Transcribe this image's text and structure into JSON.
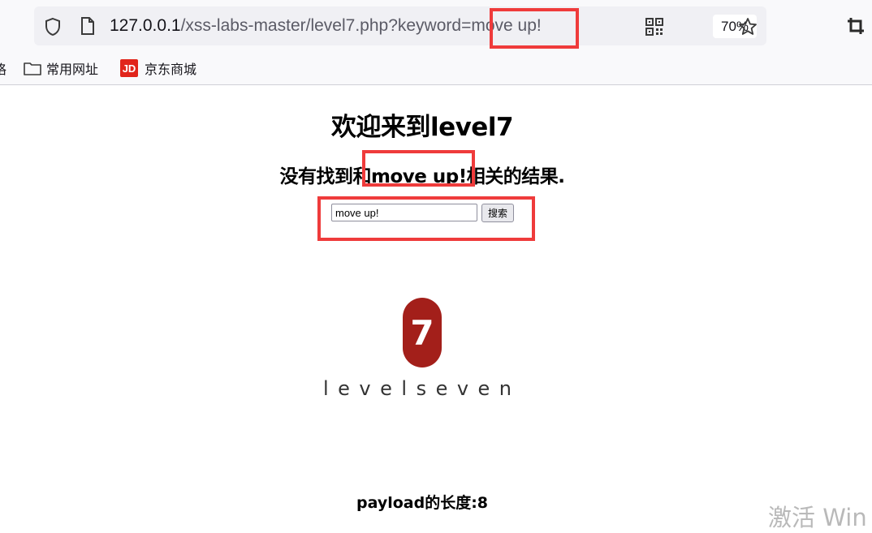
{
  "browser": {
    "url_host": "127.0.0.1",
    "url_path": "/xss-labs-master/level7.php?keyword=move up!",
    "zoom": "70%",
    "icons": [
      "shield-icon",
      "page-icon",
      "qr-code-icon",
      "star-icon",
      "crop-icon"
    ]
  },
  "bookmarks": {
    "partial_label": "咯",
    "items": [
      {
        "label": "常用网址",
        "icon": "folder-icon"
      },
      {
        "label": "京东商城",
        "icon": "jd-icon",
        "badge": "JD"
      }
    ]
  },
  "page": {
    "title": "欢迎来到level7",
    "result_prefix": "没有找到和",
    "keyword": "move up!",
    "result_suffix": "相关的结果.",
    "search": {
      "value": "move up!",
      "button_label": "搜索"
    },
    "logo": {
      "number": "7",
      "text": "levelseven"
    },
    "payload_length": "payload的长度:8"
  },
  "watermark": "激活 Win",
  "colors": {
    "highlight": "#ef3b3b",
    "logo_badge": "#a31f1a"
  }
}
